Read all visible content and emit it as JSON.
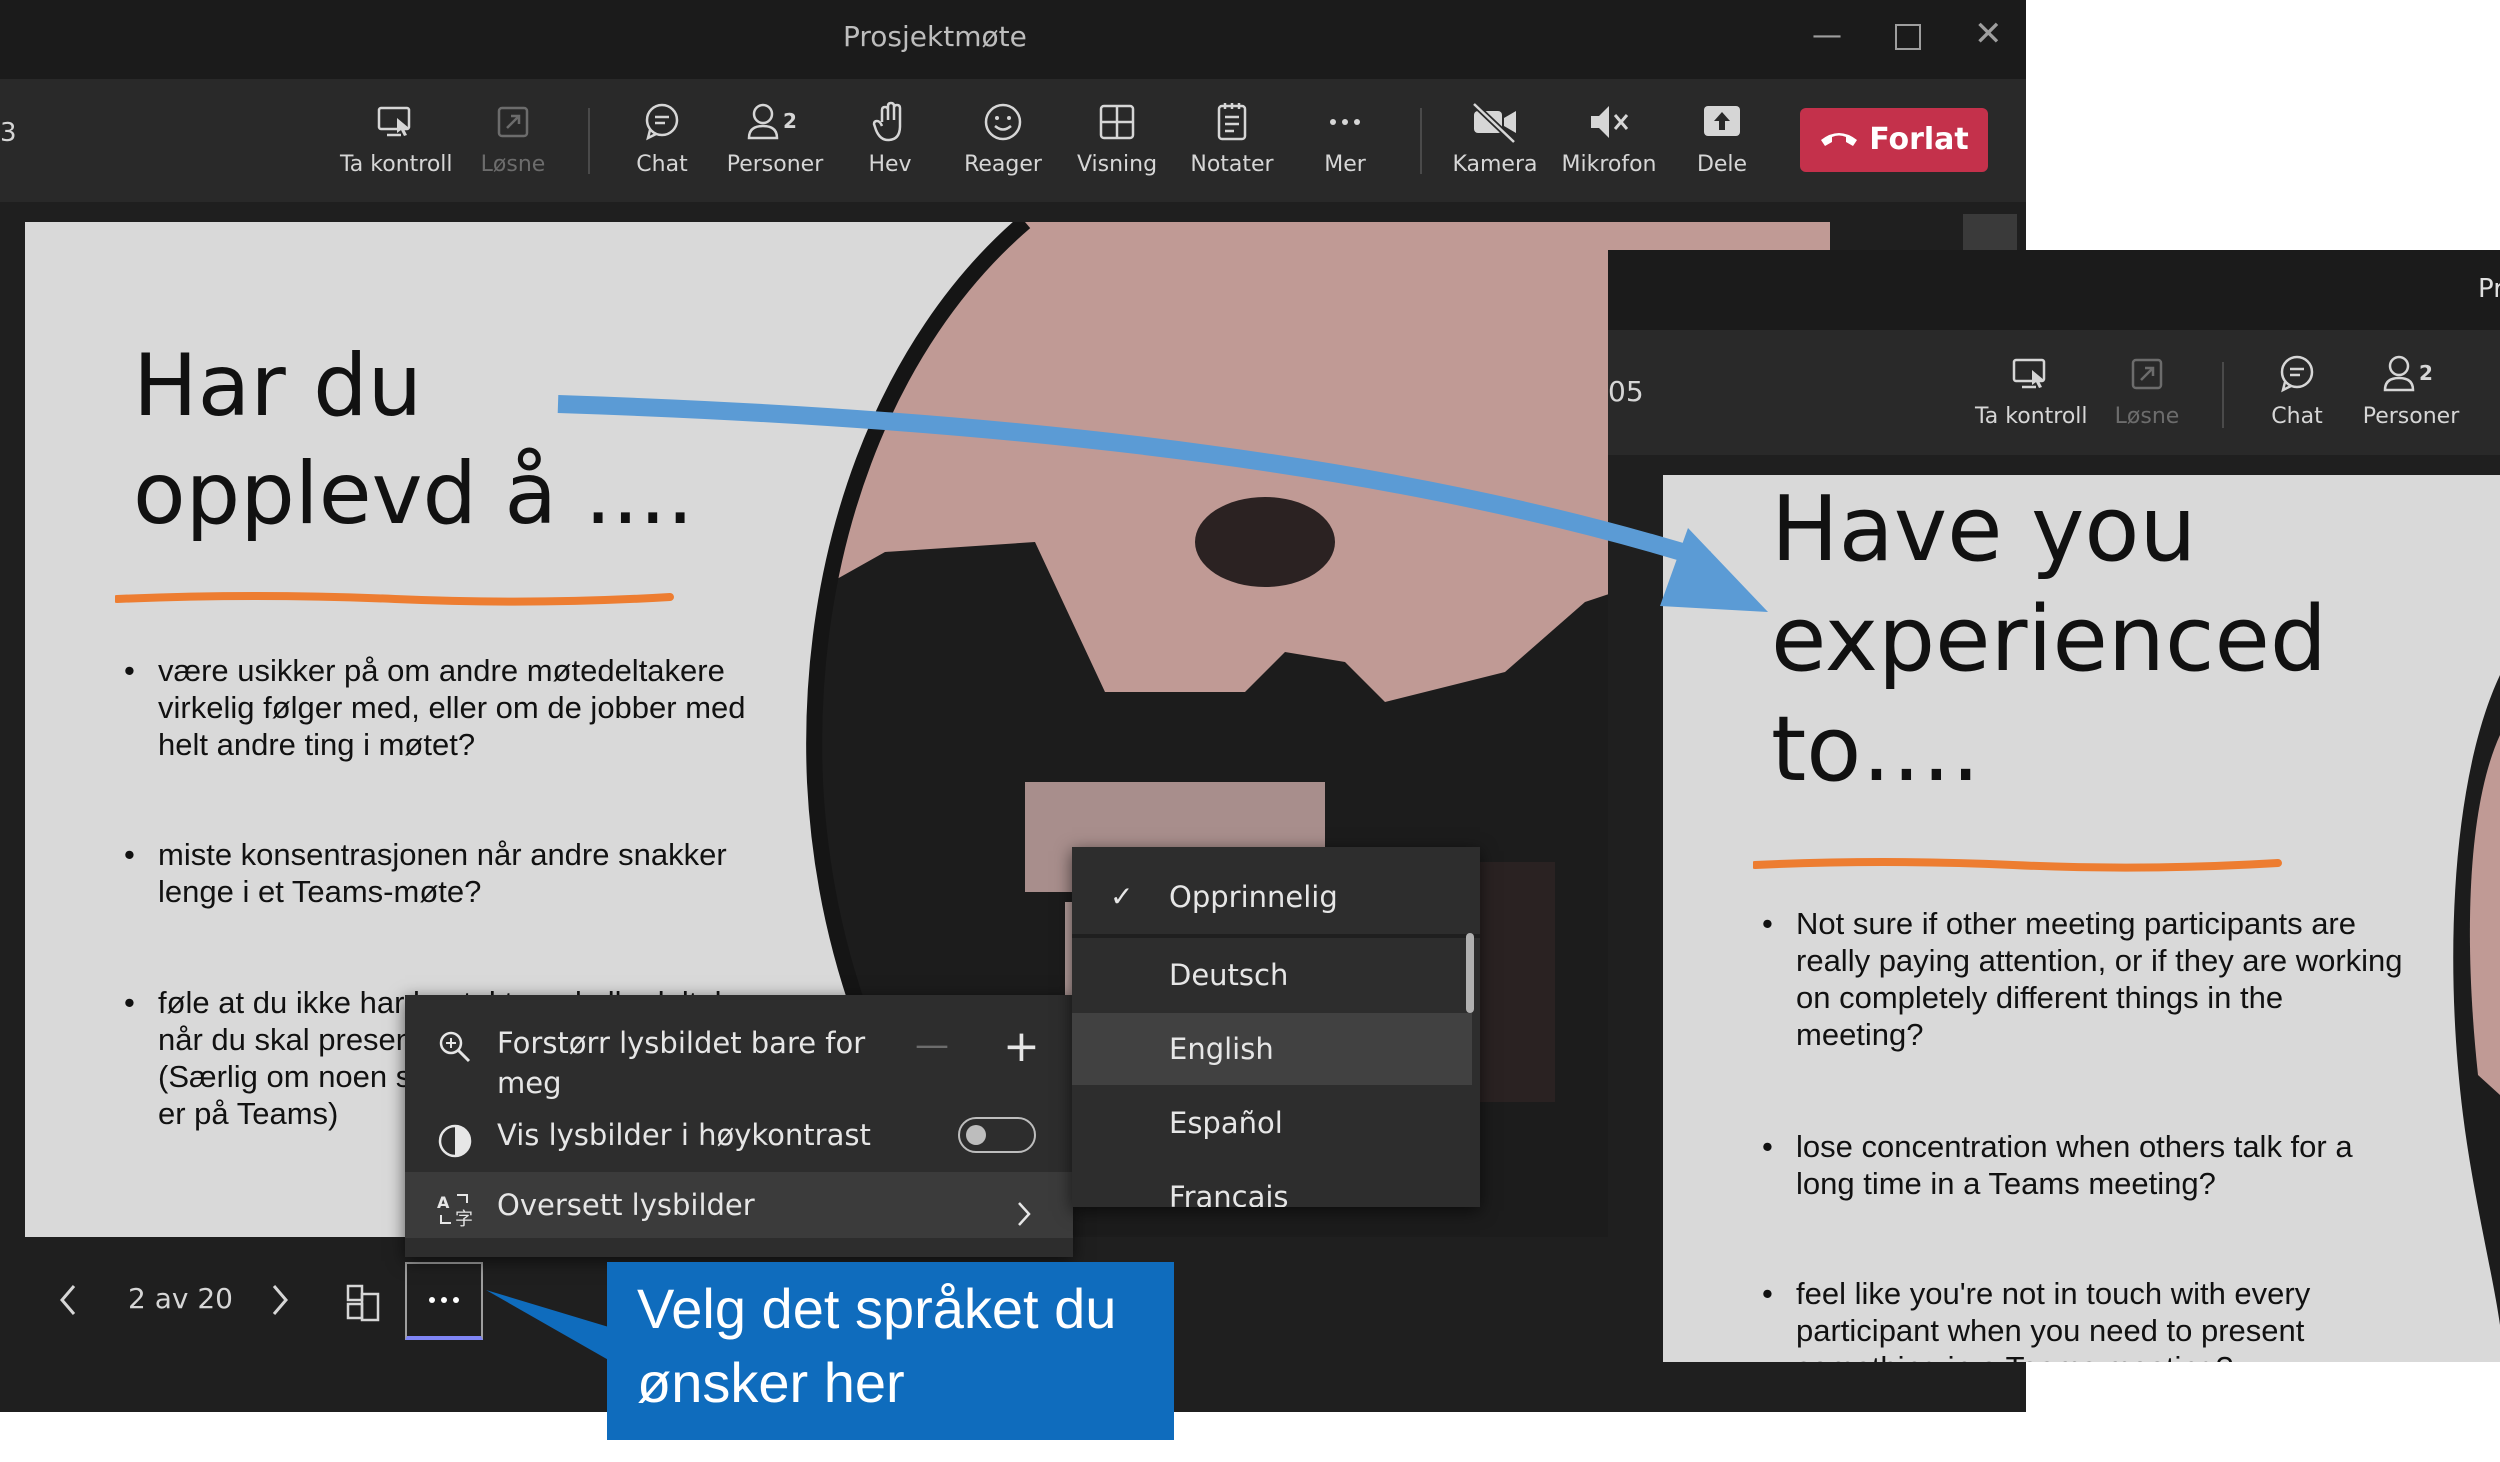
{
  "main_window": {
    "title": "Prosjektmøte",
    "partial_left": "3",
    "toolbar": [
      {
        "id": "take-control",
        "label": "Ta kontroll",
        "icon": "take-control-icon",
        "enabled": true
      },
      {
        "id": "release",
        "label": "Løsne",
        "icon": "release-icon",
        "enabled": false
      },
      {
        "id": "chat",
        "label": "Chat",
        "icon": "chat-icon",
        "enabled": true
      },
      {
        "id": "people",
        "label": "Personer",
        "icon": "people-icon",
        "badge": "2",
        "enabled": true
      },
      {
        "id": "raise",
        "label": "Hev",
        "icon": "raise-hand-icon",
        "enabled": true
      },
      {
        "id": "react",
        "label": "Reager",
        "icon": "react-icon",
        "enabled": true
      },
      {
        "id": "view",
        "label": "Visning",
        "icon": "view-icon",
        "enabled": true
      },
      {
        "id": "notes",
        "label": "Notater",
        "icon": "notes-icon",
        "enabled": true
      },
      {
        "id": "more",
        "label": "Mer",
        "icon": "more-icon",
        "enabled": true
      },
      {
        "id": "camera",
        "label": "Kamera",
        "icon": "camera-off-icon",
        "enabled": true
      },
      {
        "id": "mic",
        "label": "Mikrofon",
        "icon": "mic-muted-icon",
        "enabled": true
      },
      {
        "id": "share",
        "label": "Dele",
        "icon": "share-icon",
        "enabled": true
      }
    ],
    "leave_label": "Forlat",
    "leave_color": "#c4314b"
  },
  "slide_no": {
    "title_line1": "Har du",
    "title_line2": "opplevd å ....",
    "bullets": [
      [
        "være usikker på om andre møtedeltakere",
        "virkelig følger med, eller om de jobber med",
        "helt andre ting i møtet?"
      ],
      [
        "miste  konsentrasjonen når andre snakker",
        "lenge i et Teams-møte?"
      ],
      [
        "føle at du ikke har kontakt med alle deltakere",
        "når du skal presentere noe i et Teams-møte?",
        "(Særlig om noen skrur av kamera når de",
        "er på Teams)"
      ]
    ]
  },
  "options_menu": {
    "zoom_label_1": "Forstørr lysbildet bare for",
    "zoom_label_2": "meg",
    "high_contrast_label": "Vis lysbilder i høykontrast",
    "high_contrast_on": false,
    "translate_label": "Oversett lysbilder"
  },
  "language_menu": {
    "items": [
      {
        "label": "Opprinnelig",
        "checked": true
      },
      {
        "label": "Deutsch",
        "checked": false
      },
      {
        "label": "English",
        "checked": false,
        "hover": true
      },
      {
        "label": "Español",
        "checked": false
      },
      {
        "label": "Français",
        "checked": false
      }
    ]
  },
  "bottom_bar": {
    "page_indicator": "2 av 20"
  },
  "callout": {
    "line1": "Velg det språket du",
    "line2": "ønsker her",
    "color": "#0f6cbd"
  },
  "arrow_color": "#5b9bd5",
  "accent_underline_color": "#ed7d31",
  "second_window": {
    "title_partial": "Pr",
    "timer_partial": "05",
    "toolbar": [
      {
        "id": "take-control",
        "label": "Ta kontroll",
        "icon": "take-control-icon",
        "enabled": true
      },
      {
        "id": "release",
        "label": "Løsne",
        "icon": "release-icon",
        "enabled": false
      },
      {
        "id": "chat",
        "label": "Chat",
        "icon": "chat-icon",
        "enabled": true
      },
      {
        "id": "people",
        "label": "Personer",
        "icon": "people-icon",
        "badge": "2",
        "enabled": true
      }
    ]
  },
  "slide_en": {
    "title_line1": "Have you",
    "title_line2": "experienced",
    "title_line3": "to….",
    "bullets": [
      [
        "Not sure if other meeting participants are",
        "really paying attention, or if they are working",
        "on completely different things in the",
        "meeting?"
      ],
      [
        "lose concentration when others talk for a",
        "long time in a Teams meeting?"
      ],
      [
        "feel like you're not in touch with every",
        "participant when you need to present",
        "something in a Teams meeting?"
      ]
    ]
  }
}
